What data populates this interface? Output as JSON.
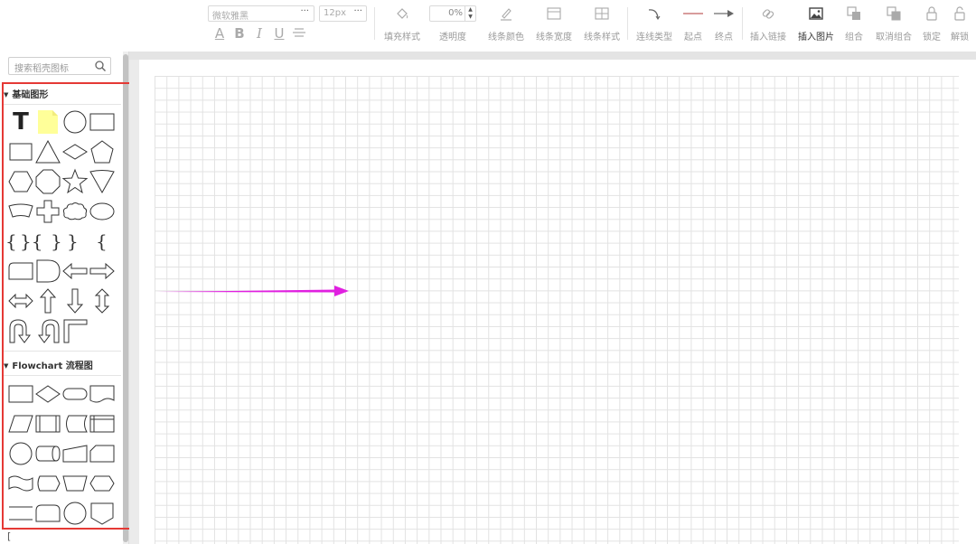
{
  "toolbar": {
    "font_family": "微软雅黑",
    "font_size": "12px",
    "opacity_value": "0%",
    "dots": "···",
    "format_buttons": [
      "A",
      "B",
      "I",
      "U"
    ],
    "labels": {
      "fill_style": "填充样式",
      "opacity": "透明度",
      "line_color": "线条颜色",
      "line_width": "线条宽度",
      "line_style": "线条样式",
      "connector_type": "连线类型",
      "start": "起点",
      "end": "终点",
      "insert_link": "插入链接",
      "insert_image": "插入图片",
      "group": "组合",
      "ungroup": "取消组合",
      "lock": "锁定",
      "unlock": "解锁"
    }
  },
  "sidebar": {
    "search_placeholder": "搜索稻壳图标",
    "sections": [
      {
        "title": "基础图形"
      },
      {
        "title": "Flowchart 流程图"
      }
    ],
    "text_tool_glyph": "T",
    "brace_glyphs": [
      "{",
      "}",
      "{",
      "}",
      "}",
      "{"
    ],
    "footer_glyph": "["
  },
  "canvas": {
    "arrow_color": "#e020e0"
  },
  "colors": {
    "highlight_frame": "#e53935",
    "note_fill": "#ffff99",
    "grid_line": "#e2e2e2"
  }
}
